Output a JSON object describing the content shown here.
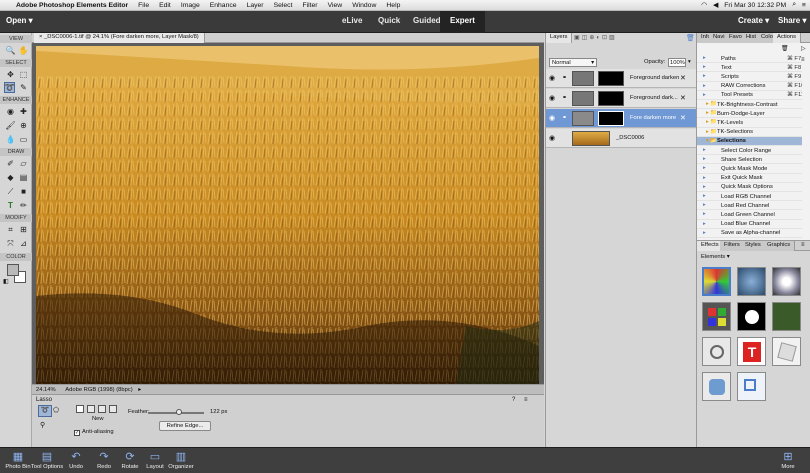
{
  "menubar": {
    "apple": "",
    "app": "Adobe Photoshop Elements Editor",
    "items": [
      "File",
      "Edit",
      "Image",
      "Enhance",
      "Layer",
      "Select",
      "Filter",
      "View",
      "Window",
      "Help"
    ],
    "datetime": "Fri Mar 30  12:32 PM"
  },
  "appbar": {
    "open": "Open",
    "modes": [
      "eLive",
      "Quick",
      "Guided",
      "Expert"
    ],
    "active_mode": "Expert",
    "create": "Create",
    "share": "Share"
  },
  "toolbox": {
    "sections": [
      "VIEW",
      "SELECT",
      "ENHANCE",
      "DRAW",
      "MODIFY",
      "COLOR"
    ]
  },
  "document": {
    "tab": "_DSC0006-1.tif @ 24.1% (Fore darken more, Layer Mask/8)",
    "zoom": "24.14%",
    "profile": "Adobe RGB (1998) (8bpc)"
  },
  "tool_options": {
    "tool": "Lasso",
    "new_label": "New",
    "feather_label": "Feather:",
    "feather_value": "122 px",
    "feather_fraction": 0.55,
    "antialias_label": "Anti-aliasing",
    "refine_button": "Refine Edge..."
  },
  "layers_panel": {
    "tab": "Layers",
    "blend_mode": "Normal",
    "opacity_label": "Opacity:",
    "opacity_value": "100%",
    "layers": [
      {
        "name": "Foreground darken",
        "selected": false
      },
      {
        "name": "Foreground dark...",
        "selected": false
      },
      {
        "name": "Fore darken more",
        "selected": true
      },
      {
        "name": "_DSC0006",
        "selected": false
      }
    ]
  },
  "right_tabs": [
    "Info",
    "Navi",
    "Favo",
    "Hist",
    "Colo",
    "Actions"
  ],
  "actions": [
    {
      "label": "Paths",
      "key": "⌘ F7",
      "type": "item"
    },
    {
      "label": "Text",
      "key": "⌘ F8",
      "type": "item"
    },
    {
      "label": "Scripts",
      "key": "⌘ F9",
      "type": "item"
    },
    {
      "label": "RAW Corrections",
      "key": "⌘ F10",
      "type": "item"
    },
    {
      "label": "Tool Presets",
      "key": "⌘ F11",
      "type": "item"
    },
    {
      "label": "TK-Brightness-Contrast",
      "key": "",
      "type": "folder"
    },
    {
      "label": "Burn-Dodge-Layer",
      "key": "",
      "type": "folder"
    },
    {
      "label": "TK-Levels",
      "key": "",
      "type": "folder"
    },
    {
      "label": "TK-Selections",
      "key": "",
      "type": "folder"
    },
    {
      "label": "Selections",
      "key": "",
      "type": "folder-open"
    },
    {
      "label": "Select Color Range",
      "key": "",
      "type": "item"
    },
    {
      "label": "Share Selection",
      "key": "",
      "type": "item"
    },
    {
      "label": "Quick Mask Mode",
      "key": "",
      "type": "item"
    },
    {
      "label": "Exit Quick Mask",
      "key": "",
      "type": "item"
    },
    {
      "label": "Quick Mask Options",
      "key": "",
      "type": "item"
    },
    {
      "label": "Load RGB Channel",
      "key": "",
      "type": "item"
    },
    {
      "label": "Load Red Channel",
      "key": "",
      "type": "item"
    },
    {
      "label": "Load Green Channel",
      "key": "",
      "type": "item"
    },
    {
      "label": "Load Blue Channel",
      "key": "",
      "type": "item"
    },
    {
      "label": "Save as Alpha-channel",
      "key": "",
      "type": "item"
    }
  ],
  "effects": {
    "tabs": [
      "Effects",
      "Filters",
      "Styles",
      "Graphics"
    ],
    "category": "Elements"
  },
  "bottombar": [
    "Photo Bin",
    "Tool Options",
    "Undo",
    "Redo",
    "Rotate",
    "Layout",
    "Organizer"
  ]
}
